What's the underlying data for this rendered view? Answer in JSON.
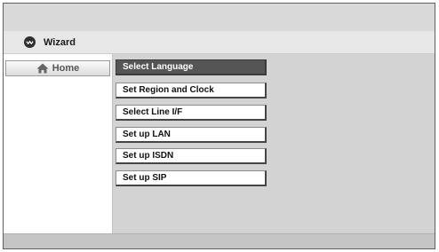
{
  "header": {
    "title": "Wizard",
    "icon": "wizard-icon"
  },
  "sidebar": {
    "home_label": "Home",
    "home_icon": "home-icon"
  },
  "menu": {
    "selected_index": 0,
    "items": [
      {
        "label": "Select Language"
      },
      {
        "label": "Set Region and Clock"
      },
      {
        "label": "Select Line I/F"
      },
      {
        "label": "Set up LAN"
      },
      {
        "label": "Set up ISDN"
      },
      {
        "label": "Set up SIP"
      }
    ]
  },
  "colors": {
    "selected_bg": "#555555",
    "panel_bg": "#d3d3d3",
    "frame": "#5f5f5f"
  }
}
